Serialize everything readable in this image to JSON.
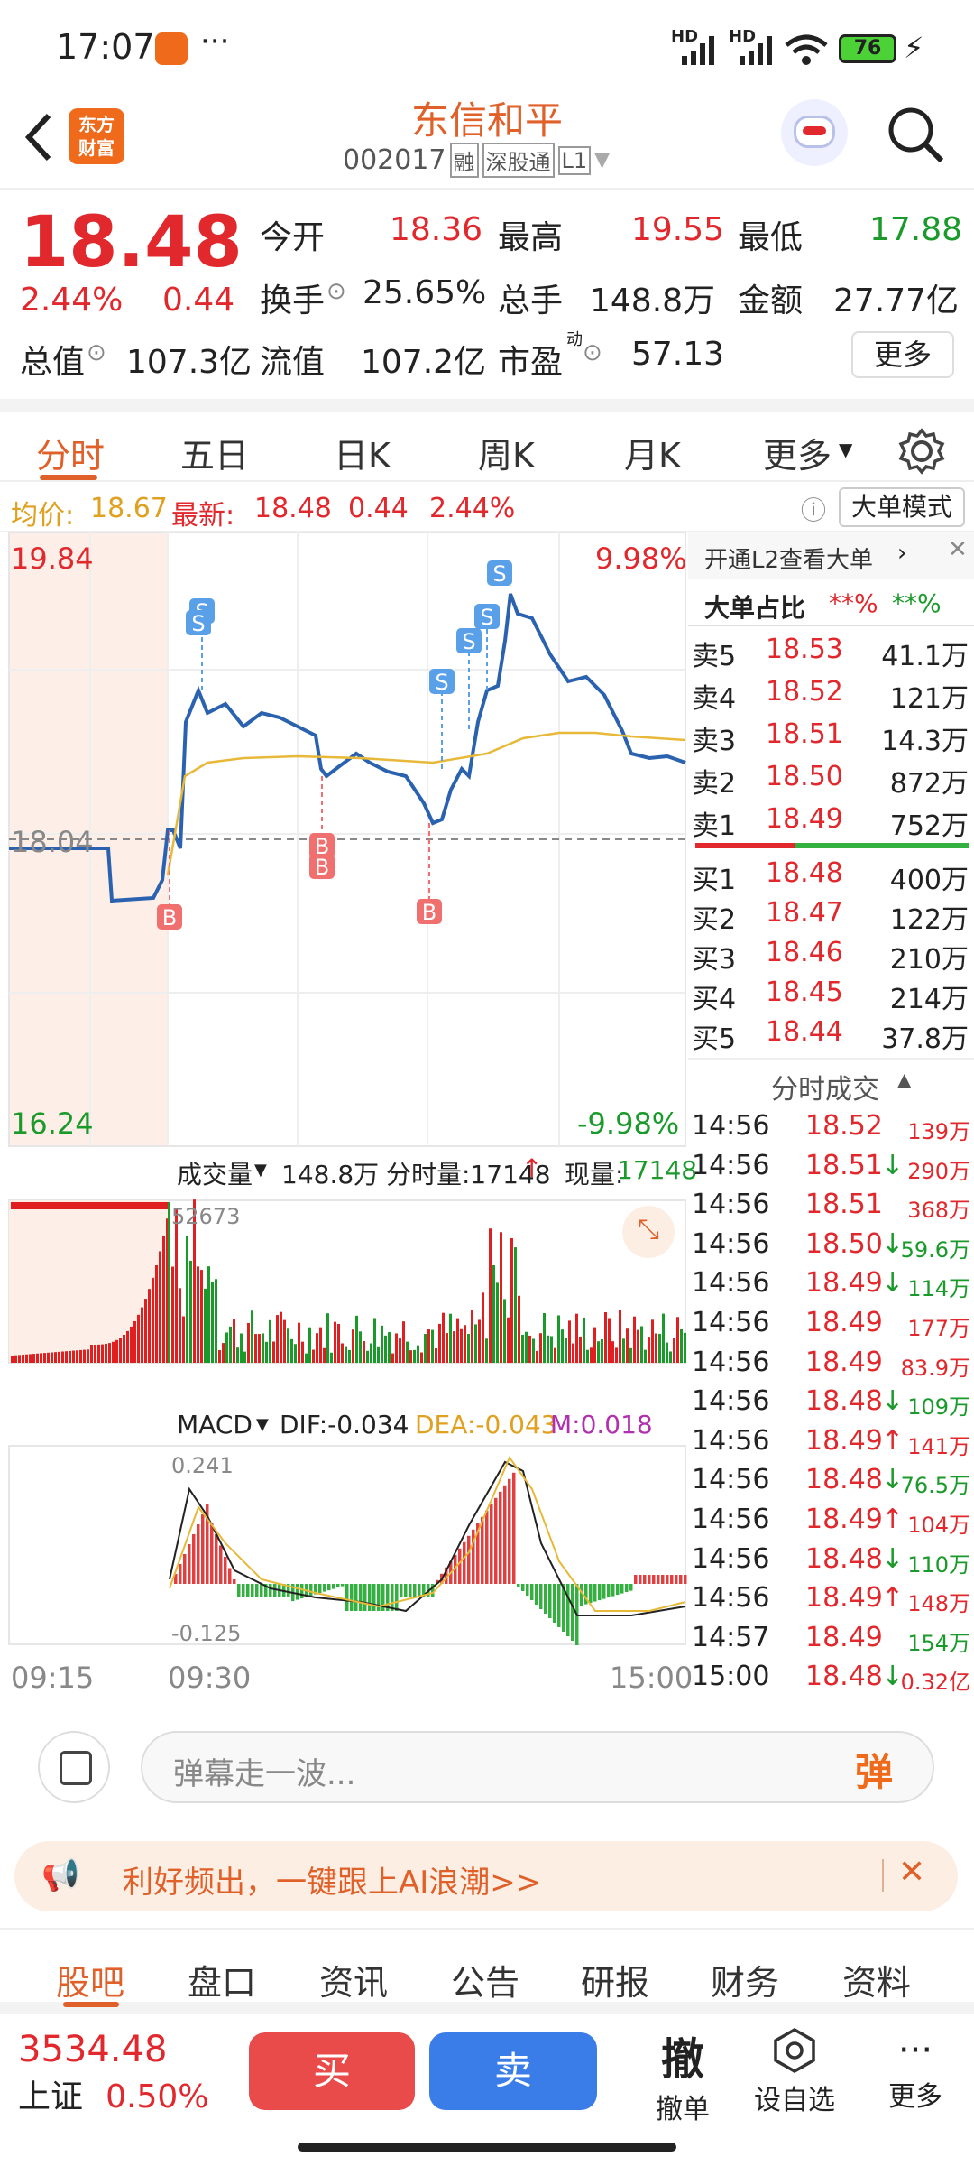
{
  "status": {
    "time": "17:07",
    "dots": "···",
    "net1": "HD",
    "net2": "HD",
    "battery": "76"
  },
  "header": {
    "app_logo_line1": "东方",
    "app_logo_line2": "财富",
    "name": "东信和平",
    "code": "002017",
    "badge1": "融",
    "badge2": "深股通",
    "badge3": "L1"
  },
  "quote": {
    "price": "18.48",
    "pct": "2.44%",
    "chg": "0.44",
    "open_label": "今开",
    "open": "18.36",
    "high_label": "最高",
    "high": "19.55",
    "low_label": "最低",
    "low": "17.88",
    "turnover_label": "换手",
    "turnover": "25.65%",
    "vol_label": "总手",
    "vol": "148.8万",
    "amount_label": "金额",
    "amount": "27.77亿",
    "mcap_label": "总值",
    "mcap": "107.3亿",
    "float_label": "流值",
    "float": "107.2亿",
    "pe_label": "市盈",
    "pe_sup": "动",
    "pe": "57.13",
    "more": "更多"
  },
  "tabs": [
    "分时",
    "五日",
    "日K",
    "周K",
    "月K",
    "更多"
  ],
  "info": {
    "avg_label": "均价:",
    "avg": "18.67",
    "latest_label": "最新:",
    "latest": "18.48",
    "chg": "0.44",
    "pct": "2.44%",
    "mode": "大单模式"
  },
  "chart": {
    "top": "19.84",
    "top_pct": "9.98%",
    "mid": "18.04",
    "bottom": "16.24",
    "bottom_pct": "-9.98%",
    "vol_label": "成交量",
    "vol_total": "148.8万",
    "vol_ind": "分时量:17148",
    "vol_now_label": "现量:",
    "vol_now": "17148",
    "vol_max": "52673",
    "macd_label": "MACD",
    "dif": "DIF:-0.034",
    "dea": "DEA:-0.043",
    "m": "M:0.018",
    "macd_top": "0.241",
    "macd_bot": "-0.125",
    "t1": "09:15",
    "t2": "09:30",
    "t3": "15:00"
  },
  "orderbook": {
    "l2": "开通L2查看大单",
    "big_label": "大单占比",
    "big_a": "**%",
    "big_b": "**%",
    "asks": [
      {
        "l": "卖5",
        "p": "18.53",
        "v": "41.1万"
      },
      {
        "l": "卖4",
        "p": "18.52",
        "v": "121万"
      },
      {
        "l": "卖3",
        "p": "18.51",
        "v": "14.3万"
      },
      {
        "l": "卖2",
        "p": "18.50",
        "v": "872万"
      },
      {
        "l": "卖1",
        "p": "18.49",
        "v": "752万"
      }
    ],
    "bids": [
      {
        "l": "买1",
        "p": "18.48",
        "v": "400万"
      },
      {
        "l": "买2",
        "p": "18.47",
        "v": "122万"
      },
      {
        "l": "买3",
        "p": "18.46",
        "v": "210万"
      },
      {
        "l": "买4",
        "p": "18.45",
        "v": "214万"
      },
      {
        "l": "买5",
        "p": "18.44",
        "v": "37.8万"
      }
    ],
    "trades_label": "分时成交",
    "trades": [
      {
        "t": "14:56",
        "p": "18.52",
        "a": "",
        "v": "139万",
        "c": "r"
      },
      {
        "t": "14:56",
        "p": "18.51",
        "a": "↓",
        "v": "290万",
        "c": "r"
      },
      {
        "t": "14:56",
        "p": "18.51",
        "a": "",
        "v": "368万",
        "c": "r"
      },
      {
        "t": "14:56",
        "p": "18.50",
        "a": "↓",
        "v": "59.6万",
        "c": "g"
      },
      {
        "t": "14:56",
        "p": "18.49",
        "a": "↓",
        "v": "114万",
        "c": "g"
      },
      {
        "t": "14:56",
        "p": "18.49",
        "a": "",
        "v": "177万",
        "c": "r"
      },
      {
        "t": "14:56",
        "p": "18.49",
        "a": "",
        "v": "83.9万",
        "c": "r"
      },
      {
        "t": "14:56",
        "p": "18.48",
        "a": "↓",
        "v": "109万",
        "c": "g"
      },
      {
        "t": "14:56",
        "p": "18.49",
        "a": "↑",
        "v": "141万",
        "c": "r"
      },
      {
        "t": "14:56",
        "p": "18.48",
        "a": "↓",
        "v": "76.5万",
        "c": "g"
      },
      {
        "t": "14:56",
        "p": "18.49",
        "a": "↑",
        "v": "104万",
        "c": "r"
      },
      {
        "t": "14:56",
        "p": "18.48",
        "a": "↓",
        "v": "110万",
        "c": "g"
      },
      {
        "t": "14:56",
        "p": "18.49",
        "a": "↑",
        "v": "148万",
        "c": "r"
      },
      {
        "t": "14:57",
        "p": "18.49",
        "a": "",
        "v": "154万",
        "c": "g"
      },
      {
        "t": "15:00",
        "p": "18.48",
        "a": "↓",
        "v": "0.32亿",
        "c": "r"
      }
    ]
  },
  "input": {
    "placeholder": "弹幕走一波...",
    "btn": "弹"
  },
  "banner": {
    "text": "利好频出，一键跟上AI浪潮>>"
  },
  "bottom_tabs": [
    "股吧",
    "盘口",
    "资讯",
    "公告",
    "研报",
    "财务",
    "资料"
  ],
  "footer": {
    "index_value": "3534.48",
    "index_name": "上证",
    "index_pct": "0.50%",
    "buy": "买",
    "sell": "卖",
    "cancel_icon": "撤",
    "cancel": "撤单",
    "watch": "设自选",
    "more": "更多"
  }
}
